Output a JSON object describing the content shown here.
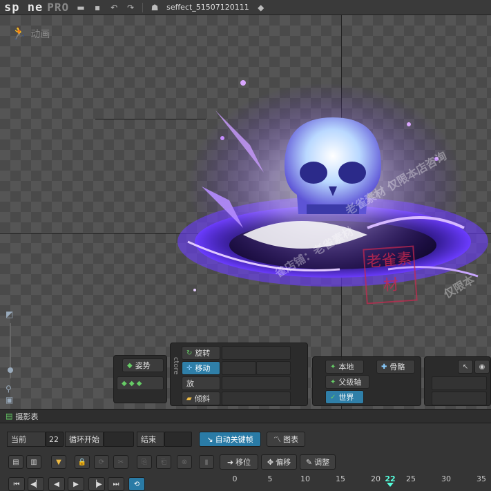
{
  "app": {
    "logo": "sp ne",
    "edition": "PRO",
    "project_name": "seffect_51507120111"
  },
  "viewport": {
    "mode_label": "动画"
  },
  "tools_panel": {
    "pose": "姿势",
    "rotate": "旋转",
    "move": "移动",
    "scale": "放",
    "shear": "倾斜",
    "vertical_label": "ctore"
  },
  "axes_panel": {
    "local": "本地",
    "bone": "骨骼",
    "parent": "父级轴",
    "world": "世界"
  },
  "dock": {
    "tab_label": "摄影表",
    "current_label": "当前",
    "current_value": "22",
    "loop_start_label": "循环开始",
    "end_label": "结束",
    "auto_key_label": "自动关键帧",
    "graph_label": "图表",
    "offset_label": "移位",
    "offset2_label": "偏移",
    "adjust_label": "调整",
    "ruler_ticks": [
      "0",
      "5",
      "10",
      "15",
      "20",
      "22",
      "25",
      "30",
      "35"
    ],
    "current_frame": 22
  },
  "watermark": {
    "text1": "老雀素材 仅限本店咨询",
    "text2": "雀店铺：老雀素材",
    "stamp": "老雀素材",
    "text3": "仅限本"
  },
  "colors": {
    "accent": "#2a7ba6",
    "playhead": "#55ffdd",
    "fx_purple": "#7a3cff"
  }
}
